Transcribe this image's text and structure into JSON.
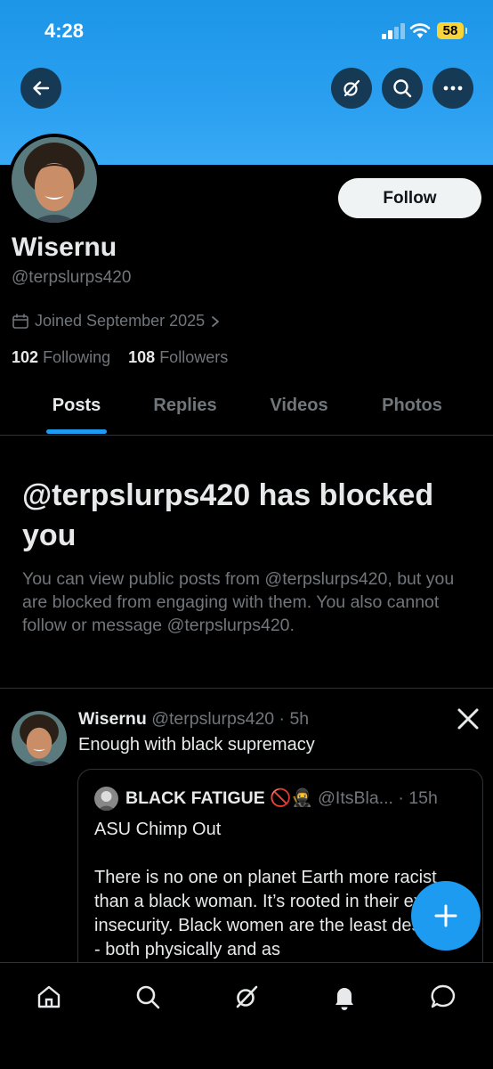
{
  "status_bar": {
    "time": "4:28",
    "battery": "58"
  },
  "header": {
    "back_icon": "arrow-left-icon",
    "grok_icon": "grok-icon",
    "search_icon": "search-icon",
    "more_icon": "more-icon",
    "banner_color": "#1d96e8"
  },
  "profile": {
    "display_name": "Wisernu",
    "handle": "@terpslurps420",
    "follow_label": "Follow",
    "joined": "Joined September 2025",
    "following_count": "102",
    "following_label": "Following",
    "followers_count": "108",
    "followers_label": "Followers"
  },
  "tabs": [
    {
      "label": "Posts",
      "active": true
    },
    {
      "label": "Replies",
      "active": false
    },
    {
      "label": "Videos",
      "active": false
    },
    {
      "label": "Photos",
      "active": false
    }
  ],
  "blocked": {
    "title": "@terpslurps420 has blocked you",
    "body": "You can view public posts from @terpslurps420, but you are blocked from engaging with them. You also cannot follow or message @terpslurps420."
  },
  "post": {
    "name": "Wisernu",
    "meta": "@terpslurps420 · 5h",
    "text": "Enough with black supremacy",
    "quote": {
      "name": "BLACK FATIGUE 🚫🥷",
      "meta": "@ItsBla... · 15h",
      "text": "ASU Chimp Out\n\nThere is no one on planet Earth more racist than a black woman. It’s rooted in their extreme insecurity. Black women are the least desirable - both physically and as"
    }
  },
  "accent_color": "#1d9bf0",
  "bottom_nav": [
    "home-icon",
    "search-icon",
    "grok-icon",
    "notifications-icon",
    "messages-icon"
  ]
}
